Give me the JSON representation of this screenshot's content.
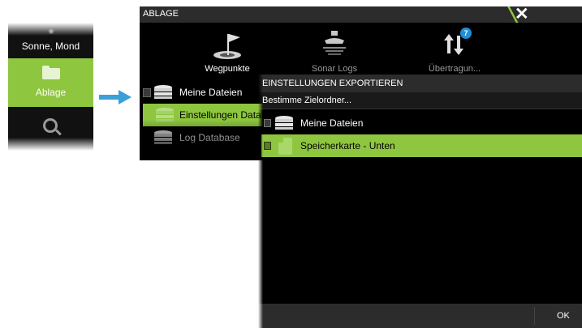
{
  "sidebar": {
    "items": [
      {
        "label": "Sonne, Mond",
        "icon": "sun-icon"
      },
      {
        "label": "Ablage",
        "icon": "folder-icon",
        "selected": true
      },
      {
        "label": "",
        "icon": "search-icon"
      }
    ]
  },
  "file_window": {
    "title": "ABLAGE",
    "tools": [
      {
        "label": "Wegpunkte",
        "icon": "flag-icon"
      },
      {
        "label": "Sonar Logs",
        "icon": "sonar-icon"
      },
      {
        "label": "Übertragun...",
        "icon": "transfer-icon",
        "badge": "7"
      }
    ],
    "files": [
      {
        "label": "Meine Dateien",
        "icon": "database-icon"
      },
      {
        "label": "Einstellungen Databas",
        "icon": "database-icon",
        "selected": true
      },
      {
        "label": "Log Database",
        "icon": "database-icon"
      }
    ]
  },
  "dialog": {
    "title": "EINSTELLUNGEN EXPORTIEREN",
    "subtitle": "Bestimme Zielordner...",
    "items": [
      {
        "label": "Meine Dateien",
        "icon": "database-icon"
      },
      {
        "label": "Speicherkarte - Unten",
        "icon": "memory-card-icon",
        "selected": true
      }
    ],
    "ok_label": "OK"
  },
  "colors": {
    "accent": "#8ec63f",
    "badge": "#1f8fd8",
    "arrow": "#3aa0d8"
  }
}
